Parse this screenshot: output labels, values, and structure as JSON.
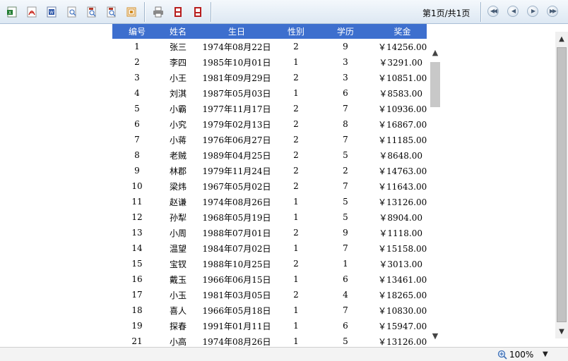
{
  "toolbar": {
    "buttons": [
      {
        "name": "export-excel-icon",
        "color": "#1d7a2e"
      },
      {
        "name": "export-pdf-icon",
        "color": "#c8261c"
      },
      {
        "name": "export-word-icon",
        "color": "#2a55a8"
      },
      {
        "name": "zoom-page-icon",
        "color": "#4d7cc4"
      },
      {
        "name": "find-icon",
        "color": "#b33a2a"
      },
      {
        "name": "find-next-icon",
        "color": "#b33a2a"
      },
      {
        "name": "export-image-icon",
        "color": "#d08a1e"
      },
      {
        "name": "print-icon",
        "color": "#555555"
      },
      {
        "name": "print-pdf-icon",
        "color": "#b81e1e"
      },
      {
        "name": "print-preview-icon",
        "color": "#b81e1e"
      }
    ],
    "page_info": "第1页/共1页"
  },
  "table": {
    "headers": [
      "编号",
      "姓名",
      "生日",
      "性别",
      "学历",
      "奖金"
    ],
    "header_color": "#3d6fce",
    "rows": [
      [
        "1",
        "张三",
        "1974年08月22日",
        "2",
        "9",
        "￥14256.00"
      ],
      [
        "2",
        "李四",
        "1985年10月01日",
        "1",
        "3",
        "￥3291.00"
      ],
      [
        "3",
        "小王",
        "1981年09月29日",
        "2",
        "3",
        "￥10851.00"
      ],
      [
        "4",
        "刘淇",
        "1987年05月03日",
        "1",
        "6",
        "￥8583.00"
      ],
      [
        "5",
        "小霸",
        "1977年11月17日",
        "2",
        "7",
        "￥10936.00"
      ],
      [
        "6",
        "小究",
        "1979年02月13日",
        "2",
        "8",
        "￥16867.00"
      ],
      [
        "7",
        "小蒋",
        "1976年06月27日",
        "2",
        "7",
        "￥11185.00"
      ],
      [
        "8",
        "老贼",
        "1989年04月25日",
        "2",
        "5",
        "￥8648.00"
      ],
      [
        "9",
        "林郡",
        "1979年11月24日",
        "2",
        "2",
        "￥14763.00"
      ],
      [
        "10",
        "梁炜",
        "1967年05月02日",
        "2",
        "7",
        "￥11643.00"
      ],
      [
        "11",
        "赵谦",
        "1974年08月26日",
        "1",
        "5",
        "￥13126.00"
      ],
      [
        "12",
        "孙犁",
        "1968年05月19日",
        "1",
        "5",
        "￥8904.00"
      ],
      [
        "13",
        "小周",
        "1988年07月01日",
        "2",
        "9",
        "￥1118.00"
      ],
      [
        "14",
        "温望",
        "1984年07月02日",
        "1",
        "7",
        "￥15158.00"
      ],
      [
        "15",
        "宝钗",
        "1988年10月25日",
        "2",
        "1",
        "￥3013.00"
      ],
      [
        "16",
        "戴玉",
        "1966年06月15日",
        "1",
        "6",
        "￥13461.00"
      ],
      [
        "17",
        "小玉",
        "1981年03月05日",
        "2",
        "4",
        "￥18265.00"
      ],
      [
        "18",
        "喜人",
        "1966年05月18日",
        "1",
        "7",
        "￥10830.00"
      ],
      [
        "19",
        "探春",
        "1991年01月11日",
        "1",
        "6",
        "￥15947.00"
      ],
      [
        "21",
        "小高",
        "1974年08月26日",
        "1",
        "5",
        "￥13126.00"
      ]
    ]
  },
  "statusbar": {
    "zoom_level": "100%"
  }
}
